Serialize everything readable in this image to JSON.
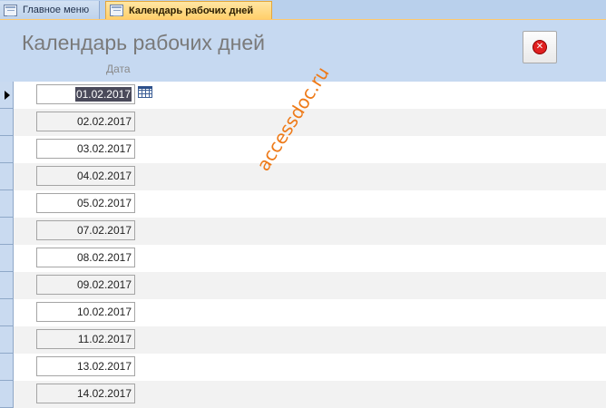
{
  "tabs": [
    {
      "label": "Главное меню",
      "active": false
    },
    {
      "label": "Календарь рабочих дней",
      "active": true
    }
  ],
  "form": {
    "title": "Календарь рабочих дней",
    "column_header": "Дата",
    "close_icon": "close-icon"
  },
  "records": [
    {
      "date": "01.02.2017"
    },
    {
      "date": "02.02.2017"
    },
    {
      "date": "03.02.2017"
    },
    {
      "date": "04.02.2017"
    },
    {
      "date": "05.02.2017"
    },
    {
      "date": "07.02.2017"
    },
    {
      "date": "08.02.2017"
    },
    {
      "date": "09.02.2017"
    },
    {
      "date": "10.02.2017"
    },
    {
      "date": "11.02.2017"
    },
    {
      "date": "13.02.2017"
    },
    {
      "date": "14.02.2017"
    }
  ],
  "watermark": "accessdoc.ru",
  "colors": {
    "tab_active": "#ffcf6a",
    "header_bg": "#c6d9f1",
    "watermark": "#ee7a18"
  }
}
